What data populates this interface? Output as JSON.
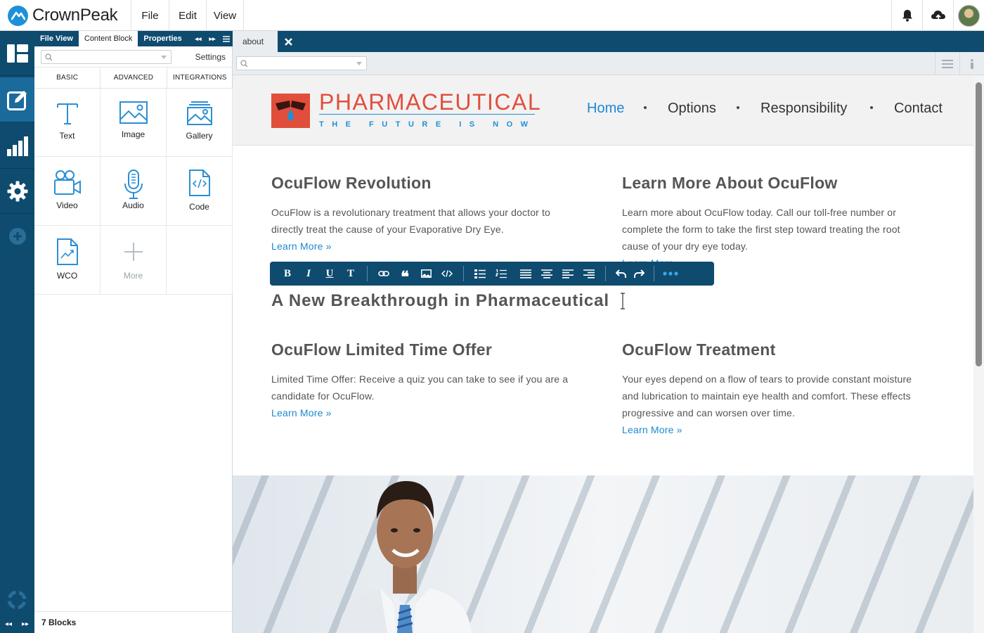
{
  "app": {
    "brand": "CrownPeak",
    "menu": [
      "File",
      "Edit",
      "View"
    ]
  },
  "panel": {
    "tabs": [
      "File View",
      "Content Block",
      "Properties"
    ],
    "selected_tab": "Content Block",
    "settings_label": "Settings",
    "categories": [
      "BASIC",
      "ADVANCED",
      "INTEGRATIONS"
    ],
    "blocks": [
      {
        "label": "Text",
        "icon": "text-icon"
      },
      {
        "label": "Image",
        "icon": "image-icon"
      },
      {
        "label": "Gallery",
        "icon": "gallery-icon"
      },
      {
        "label": "Video",
        "icon": "video-icon"
      },
      {
        "label": "Audio",
        "icon": "microphone-icon"
      },
      {
        "label": "Code",
        "icon": "code-file-icon"
      },
      {
        "label": "WCO",
        "icon": "chart-file-icon"
      },
      {
        "label": "More",
        "icon": "plus-icon"
      }
    ],
    "footer": "7 Blocks"
  },
  "editor": {
    "tab_label": "about"
  },
  "site": {
    "logo_name": "PHARMACEUTICAL",
    "logo_tagline": "THE FUTURE IS NOW",
    "nav": [
      "Home",
      "Options",
      "Responsibility",
      "Contact"
    ],
    "active_nav": "Home",
    "sections": [
      {
        "title": "OcuFlow Revolution",
        "text_lines": [
          "OcuFlow is a revolutionary treatment that allows your doctor to",
          "directly treat the cause of your Evaporative Dry Eye."
        ],
        "link": "Learn More »"
      },
      {
        "title": "Learn More About OcuFlow",
        "text_lines": [
          "Learn more about OcuFlow today. Call our toll-free number or",
          "complete the form to take the first step toward treating the root",
          "cause of your dry eye today."
        ],
        "link": "Learn More »"
      },
      {
        "title": "OcuFlow Limited Time Offer",
        "text_lines": [
          "Limited Time Offer: Receive a quiz you can take to see if you are a",
          "candidate for OcuFlow."
        ],
        "link": "Learn More »"
      },
      {
        "title": "OcuFlow Treatment",
        "text_lines": [
          "Your eyes depend on a flow of tears to provide constant moisture",
          "and lubrication to maintain eye health and comfort. These effects",
          "progressive and can worsen over time."
        ],
        "link": "Learn More »"
      }
    ],
    "headline": "A New Breakthrough in Pharmaceutical"
  },
  "colors": {
    "brand_navy": "#0e4b6f",
    "rail_active": "#1a6b9c",
    "link_blue": "#1e88d2",
    "logo_red": "#e14e3c"
  }
}
